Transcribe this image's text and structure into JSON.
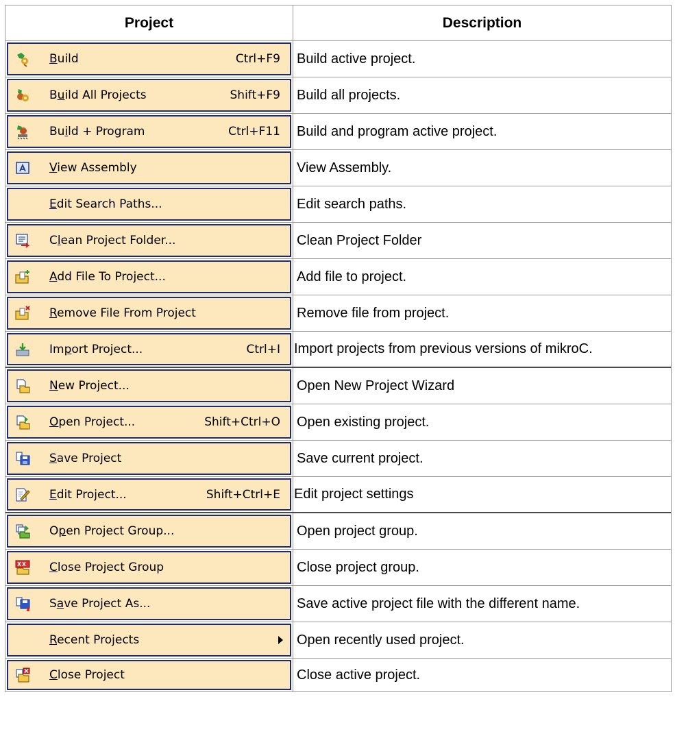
{
  "headers": {
    "project": "Project",
    "description": "Description"
  },
  "rows": [
    {
      "icon": "build-icon",
      "label_pre": "",
      "label_mn": "B",
      "label_post": "uild",
      "shortcut": "Ctrl+F9",
      "description": "Build active project."
    },
    {
      "icon": "build-all-icon",
      "label_pre": "B",
      "label_mn": "u",
      "label_post": "ild All Projects",
      "shortcut": "Shift+F9",
      "description": "Build all projects."
    },
    {
      "icon": "build-program-icon",
      "label_pre": "Bu",
      "label_mn": "i",
      "label_post": "ld + Program",
      "shortcut": "Ctrl+F11",
      "description": "Build and program active project."
    },
    {
      "icon": "view-assembly-icon",
      "label_pre": "",
      "label_mn": "V",
      "label_post": "iew Assembly",
      "shortcut": "",
      "description": "View Assembly."
    },
    {
      "icon": "",
      "label_pre": "",
      "label_mn": "E",
      "label_post": "dit Search Paths...",
      "shortcut": "",
      "description": "Edit search paths."
    },
    {
      "icon": "clean-folder-icon",
      "label_pre": "C",
      "label_mn": "l",
      "label_post": "ean Project Folder...",
      "shortcut": "",
      "description": "Clean Project Folder"
    },
    {
      "icon": "add-file-icon",
      "label_pre": "",
      "label_mn": "A",
      "label_post": "dd File To Project...",
      "shortcut": "",
      "description": "Add file to project."
    },
    {
      "icon": "remove-file-icon",
      "label_pre": "",
      "label_mn": "R",
      "label_post": "emove File From Project",
      "shortcut": "",
      "description": "Remove file from project."
    },
    {
      "icon": "import-project-icon",
      "label_pre": "Im",
      "label_mn": "p",
      "label_post": "ort Project...",
      "shortcut": "Ctrl+I",
      "description": "Import projects from previous versions of mikroC."
    },
    {
      "icon": "new-project-icon",
      "label_pre": "",
      "label_mn": "N",
      "label_post": "ew Project...",
      "shortcut": "",
      "description": "Open New Project Wizard"
    },
    {
      "icon": "open-project-icon",
      "label_pre": "",
      "label_mn": "O",
      "label_post": "pen Project...",
      "shortcut": "Shift+Ctrl+O",
      "description": "Open existing project."
    },
    {
      "icon": "save-project-icon",
      "label_pre": "",
      "label_mn": "S",
      "label_post": "ave Project",
      "shortcut": "",
      "description": "Save current project."
    },
    {
      "icon": "edit-project-icon",
      "label_pre": "",
      "label_mn": "E",
      "label_post": "dit Project...",
      "shortcut": "Shift+Ctrl+E",
      "description": "Edit project settings"
    },
    {
      "icon": "open-project-group-icon",
      "label_pre": "O",
      "label_mn": "p",
      "label_post": "en Project Group...",
      "shortcut": "",
      "description": "Open project group."
    },
    {
      "icon": "close-project-group-icon",
      "label_pre": "",
      "label_mn": "C",
      "label_post": "lose Project Group",
      "shortcut": "",
      "description": "Close project group."
    },
    {
      "icon": "save-project-as-icon",
      "label_pre": "S",
      "label_mn": "a",
      "label_post": "ve Project As...",
      "shortcut": "",
      "description": "Save active project file with the different name."
    },
    {
      "icon": "",
      "label_pre": "",
      "label_mn": "R",
      "label_post": "ecent Projects",
      "shortcut": "",
      "submenu": true,
      "description": "Open recently used project."
    },
    {
      "icon": "close-project-icon",
      "label_pre": "",
      "label_mn": "C",
      "label_post": "lose Project",
      "shortcut": "",
      "description": "Close active project."
    }
  ]
}
